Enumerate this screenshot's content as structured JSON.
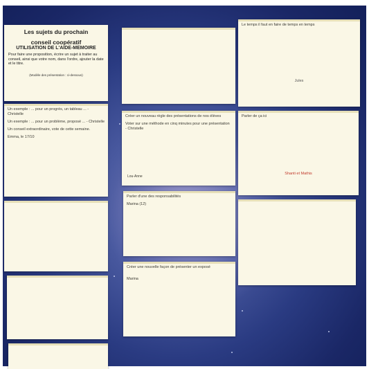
{
  "header_note": {
    "title_line1": "Les sujets du prochain",
    "title_line2": "conseil coopératif",
    "subtitle": "UTILISATION DE L'AIDE-MEMOIRE",
    "body": "Pour faire une proposition, écrire un sujet à traiter au conseil, ainsi que votre nom, dans l'ordre, ajouter la date et le titre.",
    "footer": "(Modèle des présentation : ci-dessous)"
  },
  "left_notes": [
    {
      "lines": [
        "Un exemple : ... pour un progrès,  un tableau ... - Christelle",
        "Un exemple : ... pour un problème, proposé ... - Christelle",
        "Un conseil extraordinaire, vote de cette semaine.",
        "Emma, le 17/10"
      ]
    },
    {
      "lines": []
    },
    {
      "lines": []
    },
    {
      "lines": []
    }
  ],
  "middle_notes": [
    {
      "lines": [],
      "footer": ""
    },
    {
      "lines": [
        "Créer un nouveau règle des présentations de nos élèves",
        "Voter sur une méthode en cinq minutes pour une présentation - Christelle"
      ],
      "footer": "Lou-Anne"
    },
    {
      "lines": [
        "Parler d'une des responsabilités",
        "Marina (12)"
      ],
      "footer": ""
    },
    {
      "lines": [
        "Créer une nouvelle façon de présenter un exposé",
        "Marina"
      ],
      "footer": ""
    }
  ],
  "right_notes": [
    {
      "lines": [
        "Le temps il faut en faire de temps en temps"
      ],
      "footer": "Jules"
    },
    {
      "lines": [
        "Parler de ça ici"
      ],
      "footer": "Shanti et Mathis"
    },
    {
      "lines": [],
      "footer": ""
    }
  ]
}
